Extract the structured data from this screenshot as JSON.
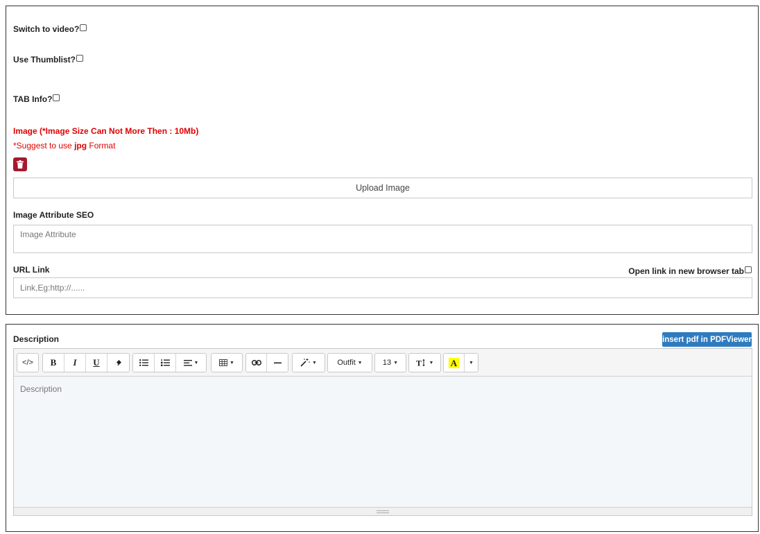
{
  "top_panel": {
    "switch_video_label": "Switch to video?",
    "thumblist_label": "Use Thumblist?",
    "tab_info_label": "TAB Info?",
    "image_label": "Image (*Image Size Can Not More Then : 10Mb)",
    "suggest_prefix": "*Suggest to use ",
    "suggest_bold": "jpg",
    "suggest_suffix": " Format",
    "upload_button": "Upload Image",
    "seo_label": "Image Attribute SEO",
    "seo_placeholder": "Image Attribute",
    "url_label": "URL Link",
    "open_new_tab_label": "Open link in new browser tab",
    "url_placeholder": "Link,Eg:http://......"
  },
  "editor": {
    "label": "Description",
    "insert_pdf_button": "insert pdf in PDFViewer",
    "placeholder": "Description",
    "toolbar": {
      "code_view": "</>",
      "bold": "B",
      "italic": "I",
      "underline": "U",
      "font_name": "Outfit",
      "font_size": "13",
      "highlight": "A"
    }
  },
  "colors": {
    "required_red": "#e00000",
    "delete_button": "#a4192f",
    "primary_blue": "#2f7bbf",
    "highlight_yellow": "#ffff00"
  }
}
